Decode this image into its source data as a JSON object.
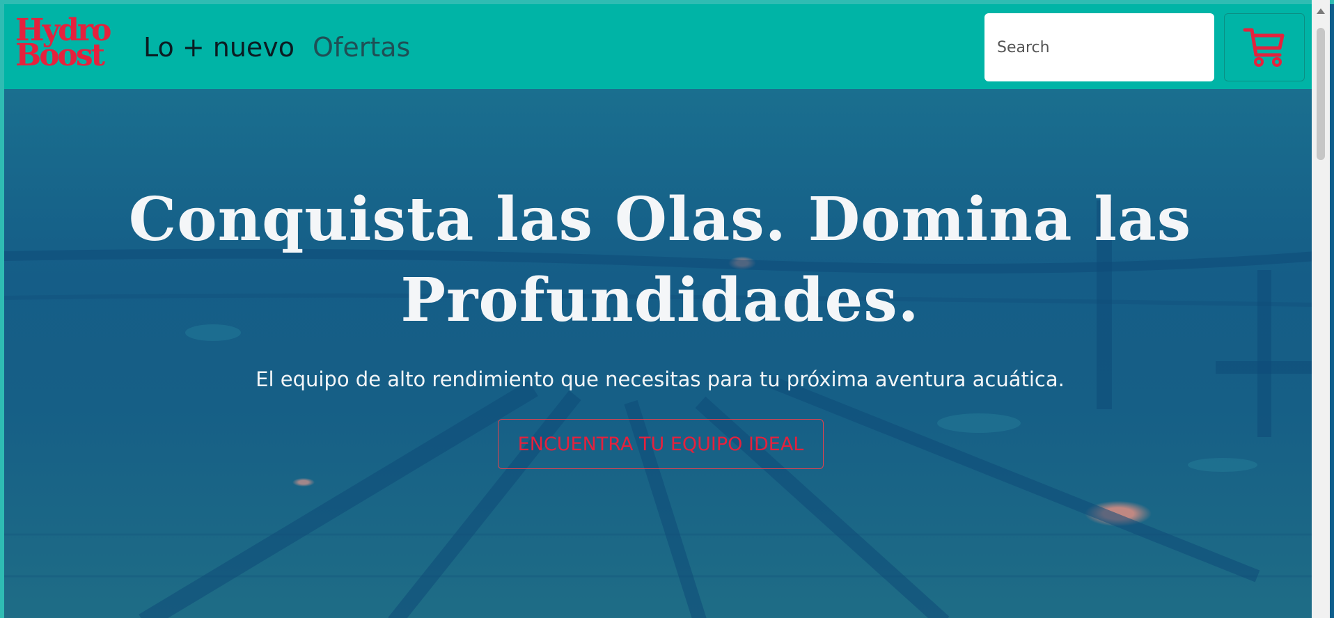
{
  "brand": {
    "logo_line1": "Hydro",
    "logo_line2": "Boost",
    "accent_color": "#e5213d",
    "navbar_color": "#00b4a6"
  },
  "nav": {
    "items": [
      {
        "label": "Lo + nuevo"
      },
      {
        "label": "Ofertas"
      }
    ]
  },
  "search": {
    "placeholder": "Search",
    "value": ""
  },
  "cart": {
    "icon": "shopping-cart-icon"
  },
  "hero": {
    "headline": "Conquista las Olas. Domina las Profundidades.",
    "subheadline": "El equipo de alto rendimiento que necesitas para tu próxima aventura acuática.",
    "cta_label": "ENCUENTRA TU EQUIPO IDEAL",
    "background": "underwater-pool-image"
  }
}
